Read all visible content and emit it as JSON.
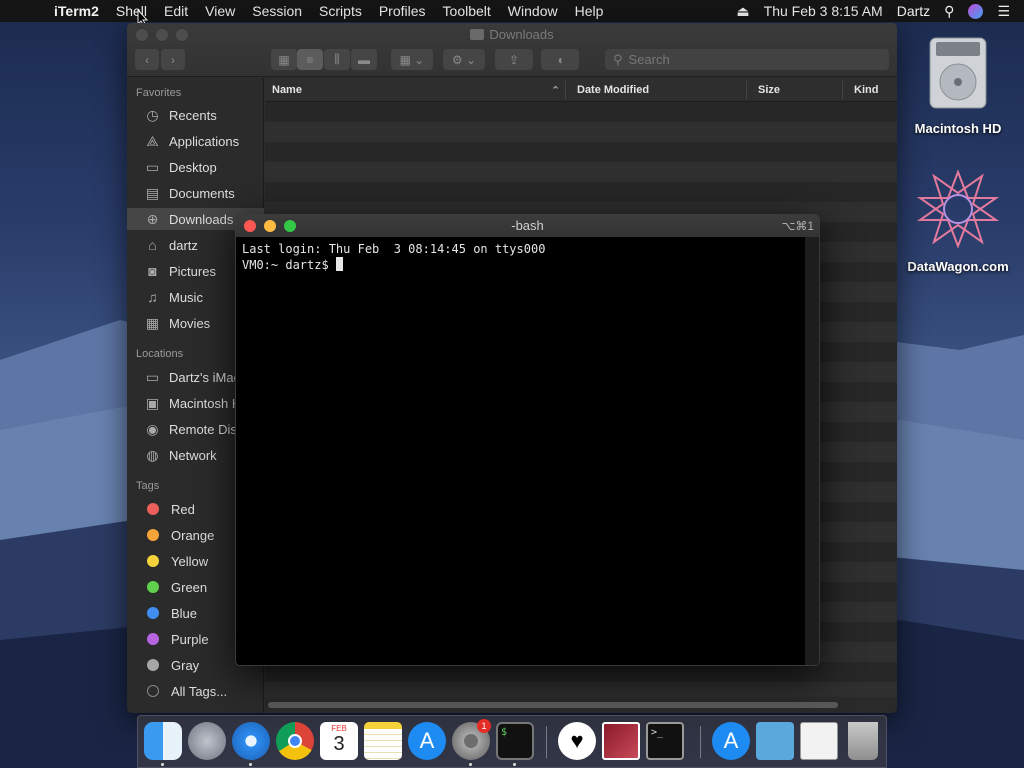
{
  "menubar": {
    "items": [
      "iTerm2",
      "Shell",
      "Edit",
      "View",
      "Session",
      "Scripts",
      "Profiles",
      "Toolbelt",
      "Window",
      "Help"
    ],
    "clock": "Thu Feb 3  8:15 AM",
    "user": "Dartz"
  },
  "finder": {
    "title": "Downloads",
    "search_placeholder": "Search",
    "columns": [
      "Name",
      "Date Modified",
      "Size",
      "Kind"
    ],
    "sidebar": {
      "favorites_heading": "Favorites",
      "favorites": [
        "Recents",
        "Applications",
        "Desktop",
        "Documents",
        "Downloads",
        "dartz",
        "Pictures",
        "Music",
        "Movies"
      ],
      "locations_heading": "Locations",
      "locations": [
        "Dartz's iMac",
        "Macintosh HD",
        "Remote Disc",
        "Network"
      ],
      "tags_heading": "Tags",
      "tags": [
        {
          "name": "Red",
          "color": "#ec5f5a"
        },
        {
          "name": "Orange",
          "color": "#f5a43a"
        },
        {
          "name": "Yellow",
          "color": "#f4d33a"
        },
        {
          "name": "Green",
          "color": "#5fcf4c"
        },
        {
          "name": "Blue",
          "color": "#3f8ef0"
        },
        {
          "name": "Purple",
          "color": "#b864e0"
        },
        {
          "name": "Gray",
          "color": "#a6a6a6"
        }
      ],
      "all_tags": "All Tags..."
    }
  },
  "terminal": {
    "title": "-bash",
    "shortcut": "⌥⌘1",
    "line1": "Last login: Thu Feb  3 08:14:45 on ttys000",
    "prompt": "VM0:~ dartz$ "
  },
  "desktop": {
    "icons": [
      "Macintosh HD",
      "DataWagon.com"
    ]
  },
  "dock": {
    "calendar_month": "FEB",
    "calendar_day": "3",
    "prefs_badge": "1"
  }
}
